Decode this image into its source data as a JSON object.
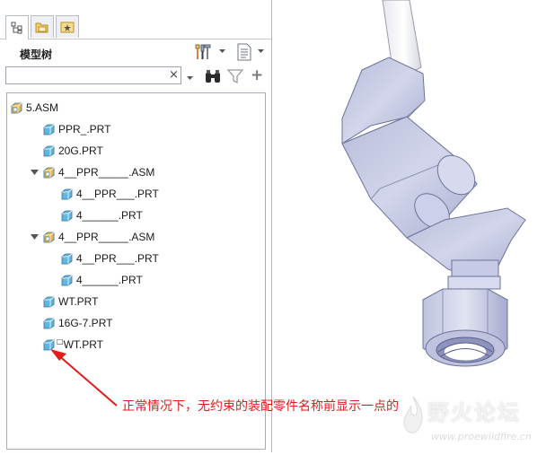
{
  "tabs": [
    {
      "name": "model-tree-icon"
    },
    {
      "name": "folder-browser-icon"
    },
    {
      "name": "favorites-icon"
    }
  ],
  "header": {
    "title": "模型树",
    "settings_icon": "tools-icon",
    "show_icon": "list-icon"
  },
  "search": {
    "value": "",
    "placeholder": "",
    "clear_label": "×",
    "add_label": "+"
  },
  "tree": {
    "nodes": [
      {
        "label": "5.ASM",
        "type": "assembly",
        "level": 0
      },
      {
        "label": "PPR_.PRT",
        "type": "part",
        "level": 1
      },
      {
        "label": "20G.PRT",
        "type": "part",
        "level": 1
      },
      {
        "label": "4__PPR_____.ASM",
        "type": "assembly",
        "level": 1,
        "expanded": true
      },
      {
        "label": "4__PPR___.PRT",
        "type": "part",
        "level": 2
      },
      {
        "label": "4______.PRT",
        "type": "part",
        "level": 2
      },
      {
        "label": "4__PPR_____.ASM",
        "type": "assembly",
        "level": 1,
        "expanded": true
      },
      {
        "label": "4__PPR___.PRT",
        "type": "part",
        "level": 2
      },
      {
        "label": "4______.PRT",
        "type": "part",
        "level": 2
      },
      {
        "label": "WT.PRT",
        "type": "part",
        "level": 1
      },
      {
        "label": "16G-7.PRT",
        "type": "part",
        "level": 1
      },
      {
        "label": "WT.PRT",
        "type": "part",
        "level": 1,
        "unconstrained_mark": "□"
      }
    ]
  },
  "annotation": {
    "text": "正常情况下，无约束的装配零件名称前显示一点的",
    "color": "#e21b1b"
  },
  "watermark": {
    "name": "野火论坛",
    "url": "www.proewildfire.cn"
  },
  "colors": {
    "part_cube": "#5fb6e0",
    "assembly_cube": "#e6b84a",
    "model_fill": "#c9cde6",
    "panel_border": "#a8adb5"
  }
}
